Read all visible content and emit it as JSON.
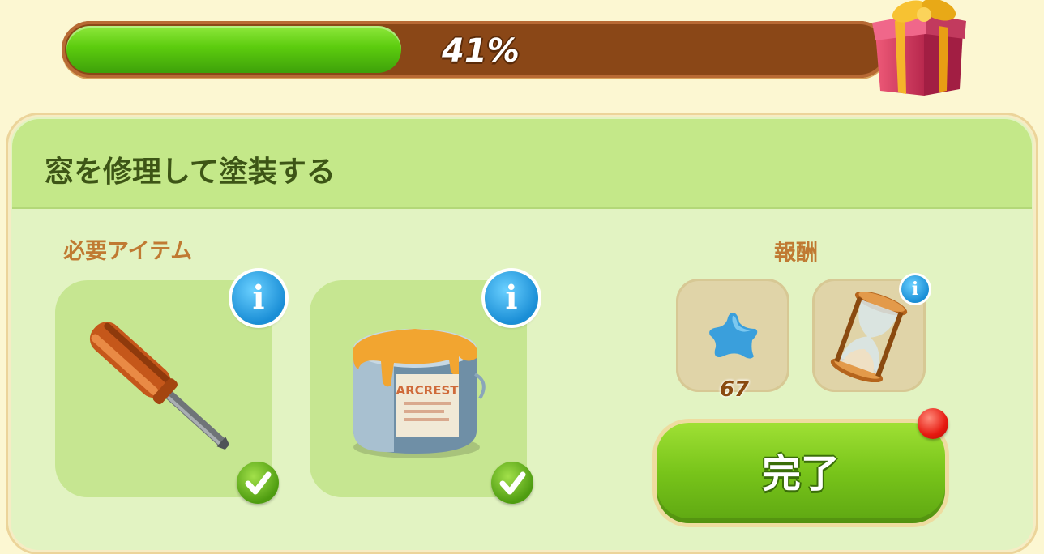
{
  "progress": {
    "percent_label": "41%",
    "value": 0.41,
    "fill_color": "#5ccc0e",
    "track_color": "#8a4717"
  },
  "task": {
    "title": "窓を修理して塗装する",
    "required_items_label": "必要アイテム",
    "rewards_label": "報酬",
    "required_items": [
      {
        "name": "screwdriver",
        "icon": "screwdriver-icon",
        "status": "complete",
        "info": "i"
      },
      {
        "name": "paint-can",
        "icon": "paint-can-icon",
        "status": "complete",
        "info": "i"
      }
    ],
    "can_label": "ARCREST",
    "rewards": [
      {
        "icon": "blue-star-icon",
        "count": "67"
      },
      {
        "icon": "hourglass-icon",
        "info": "i"
      }
    ],
    "complete_button_label": "完了"
  },
  "colors": {
    "background": "#fcf7d2",
    "panel": "#e2f3c2",
    "header": "#c4e889",
    "title_text": "#3d5516",
    "section_text": "#c07a32",
    "button": "#78c41a",
    "notification": "#e61a10"
  }
}
